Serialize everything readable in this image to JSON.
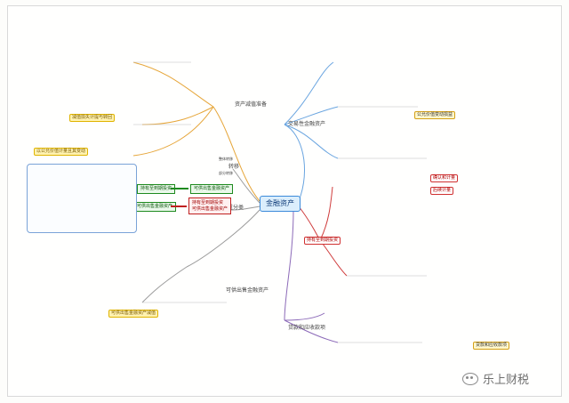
{
  "center": {
    "label": "金融资产"
  },
  "branches": {
    "top_left": "资产减值准备",
    "top_right": "交易性金融资产",
    "left_mid_1": "转移",
    "left_mid_2": "重分类",
    "right_mid": "持有至到期投资",
    "bottom_left": "可供出售金融资产",
    "bottom_right": "贷款和应收款项"
  },
  "sub_labels": {
    "transfer_1": "整体转移",
    "transfer_2": "部分转移",
    "reclass_left": "可供出售金融资产",
    "reclass_right": "持有至到期投资",
    "green_top_left": "持有至到期投资",
    "green_top_right": "可供出售金融资产",
    "green_bottom": "可供出售金融资产",
    "red_box_lines": [
      "持有至到期投资",
      "可供出售金融资产"
    ],
    "right_red_1": "确认和计量",
    "right_red_2": "后续计量",
    "yellow_top_right": "公允价值变动损益",
    "yellow_left_top": "减值损失计提与转回",
    "yellow_left_bottom": "以公允价值计量且其变动",
    "yellow_bottom": "可供出售金融资产减值",
    "right_bottom_label": "贷款和应收款项"
  },
  "watermark": {
    "text": "乐上财税"
  }
}
